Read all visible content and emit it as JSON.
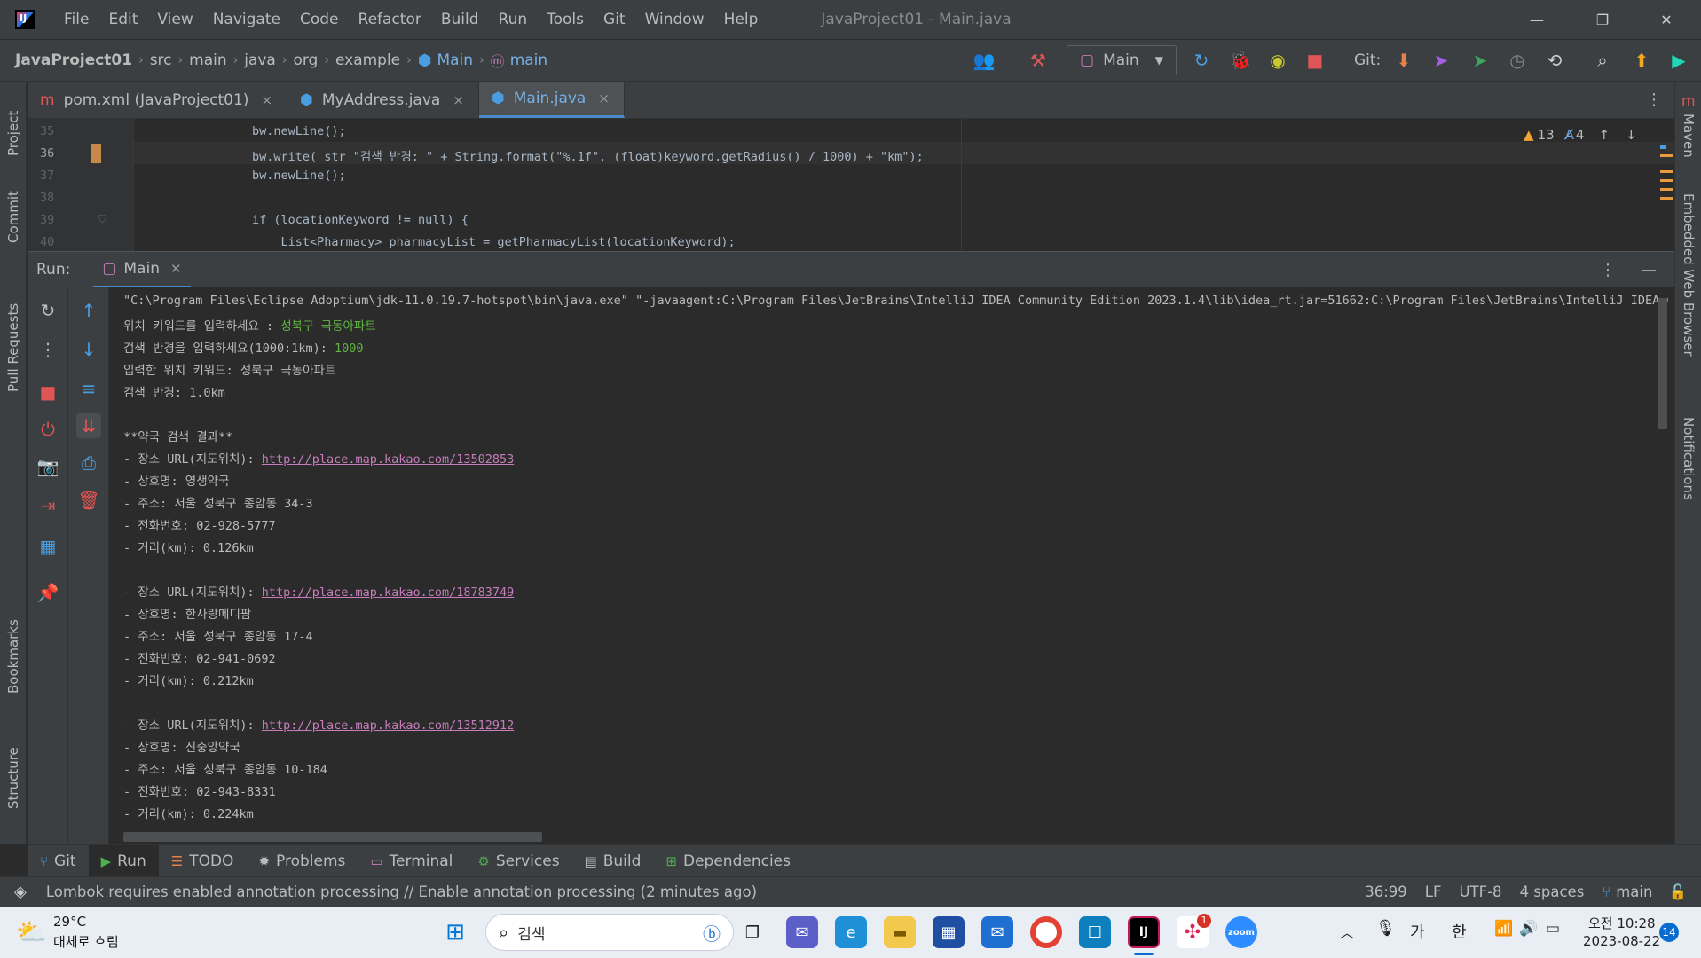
{
  "titlebar": {
    "menus": [
      "File",
      "Edit",
      "View",
      "Navigate",
      "Code",
      "Refactor",
      "Build",
      "Run",
      "Tools",
      "Git",
      "Window",
      "Help"
    ],
    "window_title": "JavaProject01 - Main.java"
  },
  "breadcrumb": [
    "JavaProject01",
    "src",
    "main",
    "java",
    "org",
    "example",
    "Main",
    "main"
  ],
  "run_config": {
    "label": "Main"
  },
  "toolbar": {
    "git_label": "Git:"
  },
  "left_tool_tabs": [
    "Project",
    "Commit",
    "Pull Requests",
    "Bookmarks",
    "Structure"
  ],
  "right_tool_tabs": [
    "Maven",
    "Embedded Web Browser",
    "Notifications"
  ],
  "editor_tabs": [
    {
      "label": "pom.xml (JavaProject01)",
      "close": "×"
    },
    {
      "label": "MyAddress.java",
      "close": "×"
    },
    {
      "label": "Main.java",
      "close": "×"
    }
  ],
  "inspection": {
    "warnings": "13",
    "typos": "4"
  },
  "editor": {
    "lines": [
      {
        "num": "35",
        "code": "        bw.newLine();"
      },
      {
        "num": "36",
        "code": "        bw.write( str \"검색 반경: \" + String.format(\"%.1f\", (float)keyword.getRadius() / 1000) + \"km\");"
      },
      {
        "num": "37",
        "code": "        bw.newLine();"
      },
      {
        "num": "38",
        "code": ""
      },
      {
        "num": "39",
        "code": "        if (locationKeyword != null) {"
      },
      {
        "num": "40",
        "code": "            List<Pharmacy> pharmacyList = getPharmacyList(locationKeyword);"
      }
    ]
  },
  "run_panel": {
    "label": "Run:",
    "tab": "Main"
  },
  "console": {
    "cmd": "\"C:\\Program Files\\Eclipse Adoptium\\jdk-11.0.19.7-hotspot\\bin\\java.exe\" \"-javaagent:C:\\Program Files\\JetBrains\\IntelliJ IDEA Community Edition 2023.1.4\\lib\\idea_rt.jar=51662:C:\\Program Files\\JetBrains\\IntelliJ IDEA Comm",
    "prompt1": "위치 키워드를 입력하세요 : ",
    "input1": "성북구 극동아파트",
    "prompt2": "검색 반경을 입력하세요(1000:1km): ",
    "input2": "1000",
    "echo1": "입력한 위치 키워드: 성북구 극동아파트",
    "echo2": "검색 반경: 1.0km",
    "result_title": "**약국 검색 결과**",
    "url_prefix": "- 장소 URL(지도위치): ",
    "results": [
      {
        "url": "http://place.map.kakao.com/13502853",
        "name": "- 상호명: 영생약국",
        "addr": "- 주소: 서울 성북구 종암동 34-3",
        "tel": "- 전화번호: 02-928-5777",
        "dist": "- 거리(km): 0.126km"
      },
      {
        "url": "http://place.map.kakao.com/18783749",
        "name": "- 상호명: 한사랑메디팜",
        "addr": "- 주소: 서울 성북구 종암동 17-4",
        "tel": "- 전화번호: 02-941-0692",
        "dist": "- 거리(km): 0.212km"
      },
      {
        "url": "http://place.map.kakao.com/13512912",
        "name": "- 상호명: 신중앙약국",
        "addr": "- 주소: 서울 성북구 종암동 10-184",
        "tel": "- 전화번호: 02-943-8331",
        "dist": "- 거리(km): 0.224km"
      }
    ]
  },
  "bottom_tabs": [
    "Git",
    "Run",
    "TODO",
    "Problems",
    "Terminal",
    "Services",
    "Build",
    "Dependencies"
  ],
  "status": {
    "message": "Lombok requires enabled annotation processing // Enable annotation processing (2 minutes ago)",
    "position": "36:99",
    "line_sep": "LF",
    "encoding": "UTF-8",
    "indent": "4 spaces",
    "branch": "main"
  },
  "taskbar": {
    "weather_temp": "29°C",
    "weather_desc": "대체로 흐림",
    "search_placeholder": "검색",
    "ime1": "가",
    "ime2": "한",
    "time": "오전 10:28",
    "date": "2023-08-22",
    "notif_count": "14",
    "slack_badge": "1"
  },
  "colors": {
    "accent": "#4a88c7",
    "link": "#c77dbb",
    "input_green": "#62b543",
    "stop_red": "#e05555"
  }
}
